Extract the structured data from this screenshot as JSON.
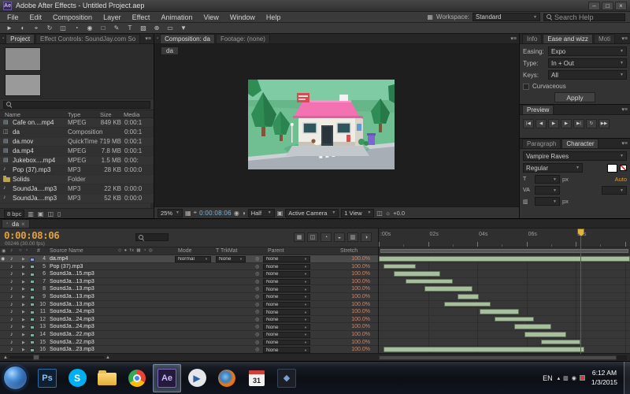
{
  "window": {
    "badge": "Ae",
    "title": "Adobe After Effects - Untitled Project.aep",
    "minimize": "–",
    "maximize": "□",
    "close": "×"
  },
  "menubar": {
    "items": [
      "File",
      "Edit",
      "Composition",
      "Layer",
      "Effect",
      "Animation",
      "View",
      "Window",
      "Help"
    ],
    "workspace_label": "Workspace:",
    "workspace_value": "Standard",
    "search_help": "Search Help"
  },
  "tools": [
    "selection",
    "hand",
    "zoom",
    "orbit",
    "pan-behind",
    "rotate",
    "unified-camera",
    "mask-shape",
    "pen",
    "type",
    "brush",
    "clone-stamp",
    "eraser",
    "puppet-pin"
  ],
  "project": {
    "tabs": [
      {
        "label": "Project",
        "active": true
      },
      {
        "label": "Effect Controls: SoundJay.com So",
        "active": false
      }
    ],
    "columns": [
      "Name",
      "Type",
      "Size",
      "Media Durat"
    ],
    "items": [
      {
        "name": "Cafe on....mp4",
        "type": "MPEG",
        "size": "849 KB",
        "dur": "0:00:1",
        "icon": "film"
      },
      {
        "name": "da",
        "type": "Composition",
        "size": "",
        "dur": "0:00:1",
        "icon": "comp"
      },
      {
        "name": "da.mov",
        "type": "QuickTime",
        "size": "719 MB",
        "dur": "0:00:1",
        "icon": "film"
      },
      {
        "name": "da.mp4",
        "type": "MPEG",
        "size": "7.8 MB",
        "dur": "0:00:1",
        "icon": "film"
      },
      {
        "name": "Jukebox....mp4",
        "type": "MPEG",
        "size": "1.5 MB",
        "dur": "0:00:",
        "icon": "film"
      },
      {
        "name": "Pop (37).mp3",
        "type": "MP3",
        "size": "28 KB",
        "dur": "0:00:0",
        "icon": "audio"
      },
      {
        "name": "Solids",
        "type": "Folder",
        "size": "",
        "dur": "",
        "icon": "folder"
      },
      {
        "name": "SoundJa....mp3",
        "type": "MP3",
        "size": "22 KB",
        "dur": "0:00:0",
        "icon": "audio"
      },
      {
        "name": "SoundJa....mp3",
        "type": "MP3",
        "size": "52 KB",
        "dur": "0:00:0",
        "icon": "audio"
      }
    ],
    "footer_bpc": "8 bpc",
    "footer_icons": [
      "interpret-footage",
      "new-folder",
      "new-composition",
      "delete"
    ]
  },
  "viewer": {
    "tabs": [
      {
        "label": "Composition: da",
        "active": true
      },
      {
        "label": "Footage: (none)",
        "active": false
      }
    ],
    "comp_chip": "da",
    "controls": {
      "zoom": "25%",
      "timecode": "0:00:08:06",
      "resolution": "Half",
      "camera": "Active Camera",
      "views": "1 View",
      "exposure": "+0.0"
    }
  },
  "ease": {
    "tabs": [
      {
        "label": "Info",
        "active": false
      },
      {
        "label": "Ease and wizz",
        "active": true
      },
      {
        "label": "Moti",
        "active": false
      }
    ],
    "rows": [
      {
        "label": "Easing:",
        "value": "Expo"
      },
      {
        "label": "Type:",
        "value": "In + Out"
      },
      {
        "label": "Keys:",
        "value": "All"
      }
    ],
    "checkbox_label": "Curvaceous",
    "apply_label": "Apply"
  },
  "preview": {
    "tab": "Preview",
    "buttons": [
      "first-frame",
      "frame-back",
      "play",
      "frame-forward",
      "last-frame",
      "loop",
      "ram-preview"
    ]
  },
  "character": {
    "tabs": [
      {
        "label": "Paragraph",
        "active": false
      },
      {
        "label": "Character",
        "active": true
      }
    ],
    "font": "Vampire Raves",
    "style": "Regular",
    "unit": "px",
    "auto": "Auto"
  },
  "timeline": {
    "tab_label": "da",
    "tab_close": "×",
    "timecode": "0:00:08:06",
    "frames": "00246 (30.00 fps)",
    "icon_buttons": [
      "composition-mini-flowchart",
      "live-update",
      "draft-3d",
      "hide-shy",
      "frame-blend",
      "motion-blur"
    ],
    "columns": {
      "num": "#",
      "name": "Source Name",
      "switches": "◇ ● fx ▦ ◔ ◎",
      "mode": "Mode",
      "trkmat": "T TrkMat",
      "parent": "Parent",
      "stretch": "Stretch"
    },
    "ruler": [
      {
        "label": ":00s",
        "sec": 0
      },
      {
        "label": "02s",
        "sec": 2
      },
      {
        "label": "04s",
        "sec": 4
      },
      {
        "label": "06s",
        "sec": 6
      },
      {
        "label": "08s",
        "sec": 8
      }
    ],
    "playhead_sec": 8.2,
    "seconds_visible": 10.2,
    "layers": [
      {
        "num": "4",
        "name": "da.mp4",
        "mode": "Normal",
        "trkmat": "None",
        "parent": "None",
        "stretch": "100.0%",
        "selected": true,
        "video": true,
        "bar": [
          0,
          10.2
        ]
      },
      {
        "num": "5",
        "name": "Pop (37).mp3",
        "parent": "None",
        "stretch": "100.0%",
        "bar": [
          0.2,
          1.5
        ]
      },
      {
        "num": "6",
        "name": "SoundJa...15.mp3",
        "parent": "None",
        "stretch": "100.0%",
        "bar": [
          0.6,
          2.5
        ]
      },
      {
        "num": "7",
        "name": "SoundJa...13.mp3",
        "parent": "None",
        "stretch": "100.0%",
        "bar": [
          1.1,
          3.0
        ]
      },
      {
        "num": "8",
        "name": "SoundJa...13.mp3",
        "parent": "None",
        "stretch": "100.0%",
        "bar": [
          1.85,
          3.8
        ]
      },
      {
        "num": "9",
        "name": "SoundJa...13.mp3",
        "parent": "None",
        "stretch": "100.0%",
        "bar": [
          3.2,
          4.05
        ]
      },
      {
        "num": "10",
        "name": "SoundJa...13.mp3",
        "parent": "None",
        "stretch": "100.0%",
        "bar": [
          2.65,
          4.55
        ]
      },
      {
        "num": "11",
        "name": "SoundJa...24.mp3",
        "parent": "None",
        "stretch": "100.0%",
        "bar": [
          4.1,
          5.7
        ]
      },
      {
        "num": "12",
        "name": "SoundJa...24.mp3",
        "parent": "None",
        "stretch": "100.0%",
        "bar": [
          4.7,
          6.3
        ]
      },
      {
        "num": "13",
        "name": "SoundJa...24.mp3",
        "parent": "None",
        "stretch": "100.0%",
        "bar": [
          5.5,
          7.0
        ]
      },
      {
        "num": "14",
        "name": "SoundJa...22.mp3",
        "parent": "None",
        "stretch": "100.0%",
        "bar": [
          5.9,
          7.6
        ]
      },
      {
        "num": "15",
        "name": "SoundJa...22.mp3",
        "parent": "None",
        "stretch": "100.0%",
        "bar": [
          6.6,
          8.2
        ]
      },
      {
        "num": "16",
        "name": "SoundJa...23.mp3",
        "parent": "None",
        "stretch": "100.0%",
        "bar": [
          0.2,
          8.35
        ]
      }
    ]
  },
  "taskbar": {
    "items": [
      {
        "name": "taskbar-photoshop",
        "shape": "square",
        "label": "Ps",
        "bg": "#0d2033",
        "fg": "#8fc0ea",
        "border": "#2e6ca8"
      },
      {
        "name": "taskbar-skype",
        "shape": "circle",
        "label": "S",
        "bg": "#00aff0",
        "fg": "#ffffff"
      },
      {
        "name": "taskbar-explorer",
        "shape": "folder"
      },
      {
        "name": "taskbar-chrome",
        "shape": "chrome"
      },
      {
        "name": "taskbar-aftereffects",
        "shape": "square",
        "label": "Ae",
        "bg": "#241a3d",
        "fg": "#cbb8f2",
        "border": "#7a68b8",
        "active": true
      },
      {
        "name": "taskbar-mediaplayer",
        "shape": "circle",
        "label": "▶",
        "bg": "#e4e6ea",
        "fg": "#2b5fa8"
      },
      {
        "name": "taskbar-firefox",
        "shape": "firefox"
      },
      {
        "name": "taskbar-calendar",
        "shape": "calendar",
        "label": "31"
      },
      {
        "name": "taskbar-vlc",
        "shape": "square",
        "label": "◆",
        "bg": "#1b1e26",
        "fg": "#7f9fd0",
        "border": "#394456"
      }
    ],
    "tray": {
      "lang": "EN",
      "time": "6:12 AM",
      "date": "1/3/2015"
    }
  }
}
